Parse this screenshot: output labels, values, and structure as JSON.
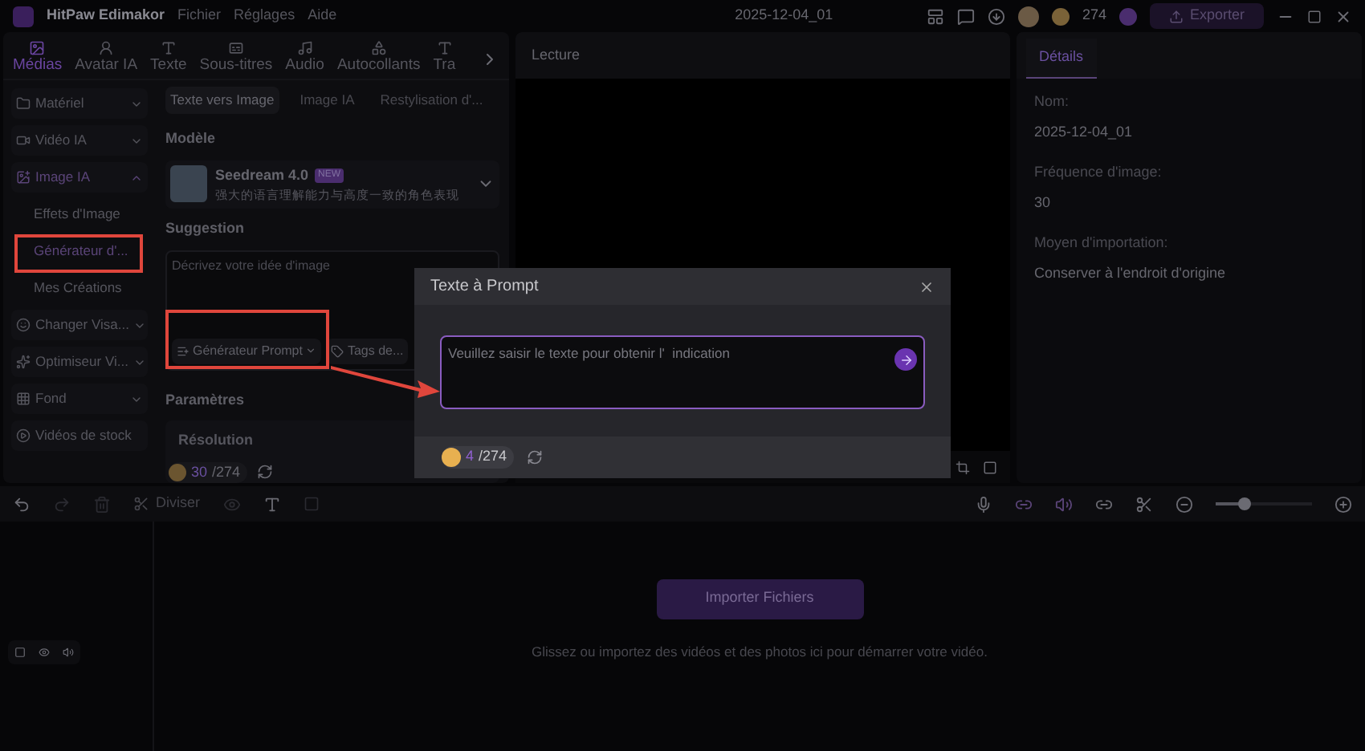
{
  "title_bar": {
    "app_name": "HitPaw Edimakor",
    "menu": [
      "Fichier",
      "Réglages",
      "Aide"
    ],
    "project_title": "2025-12-04_01",
    "credits": "274",
    "export": "Exporter"
  },
  "media_tabs": [
    {
      "label": "Médias",
      "selected": true
    },
    {
      "label": "Avatar IA",
      "selected": false
    },
    {
      "label": "Texte",
      "selected": false
    },
    {
      "label": "Sous-titres",
      "selected": false
    },
    {
      "label": "Audio",
      "selected": false
    },
    {
      "label": "Autocollants",
      "selected": false
    },
    {
      "label": "Tra",
      "selected": false
    }
  ],
  "sidebar": {
    "items": [
      {
        "label": "Matériel",
        "expanded": false,
        "selected": false
      },
      {
        "label": "Vidéo IA",
        "expanded": false,
        "selected": false
      },
      {
        "label": "Image IA",
        "expanded": true,
        "selected": true,
        "children": [
          {
            "label": "Effets d'Image",
            "selected": false
          },
          {
            "label": "Générateur d'...",
            "selected": true
          },
          {
            "label": "Mes Créations",
            "selected": false
          }
        ]
      },
      {
        "label": "Changer Visa...",
        "expanded": false,
        "selected": false
      },
      {
        "label": "Optimiseur Vi...",
        "expanded": false,
        "selected": false
      },
      {
        "label": "Fond",
        "expanded": false,
        "selected": false
      },
      {
        "label": "Vidéos de stock",
        "selected": false
      }
    ]
  },
  "ai_tabs": [
    {
      "label": "Texte vers Image",
      "selected": true
    },
    {
      "label": "Image IA",
      "selected": false
    },
    {
      "label": "Restylisation d'...",
      "selected": false
    }
  ],
  "model": {
    "heading": "Modèle",
    "name": "Seedream 4.0",
    "badge": "NEW",
    "description": "强大的语言理解能力与高度一致的角色表现"
  },
  "suggestion": {
    "heading": "Suggestion",
    "placeholder": "Décrivez votre idée d'image",
    "buttons": [
      "Générateur Prompt",
      "Tags de..."
    ]
  },
  "parameters": {
    "heading": "Paramètres",
    "resolution": "Résolution",
    "credits_used": "30",
    "credits_total": "/274"
  },
  "player": {
    "title": "Lecture"
  },
  "details": {
    "tab": {
      "label": "Détails",
      "selected": true
    },
    "fields": [
      {
        "label": "Nom:",
        "value": "2025-12-04_01"
      },
      {
        "label": "Fréquence d'image:",
        "value": "30"
      },
      {
        "label": "Moyen d'importation:",
        "value": "Conserver à l'endroit d'origine"
      }
    ]
  },
  "toolbar": {
    "split": "Diviser",
    "zoom": {
      "level": 0.3
    }
  },
  "timeline": {
    "import_button": "Importer Fichiers",
    "hint": "Glissez ou importez des vidéos et des photos ici pour démarrer votre vidéo."
  },
  "dialog": {
    "title": "Texte à Prompt",
    "placeholder": "Veuillez saisir le texte pour obtenir l'  indication",
    "credits_used": "4",
    "credits_total": "/274"
  }
}
